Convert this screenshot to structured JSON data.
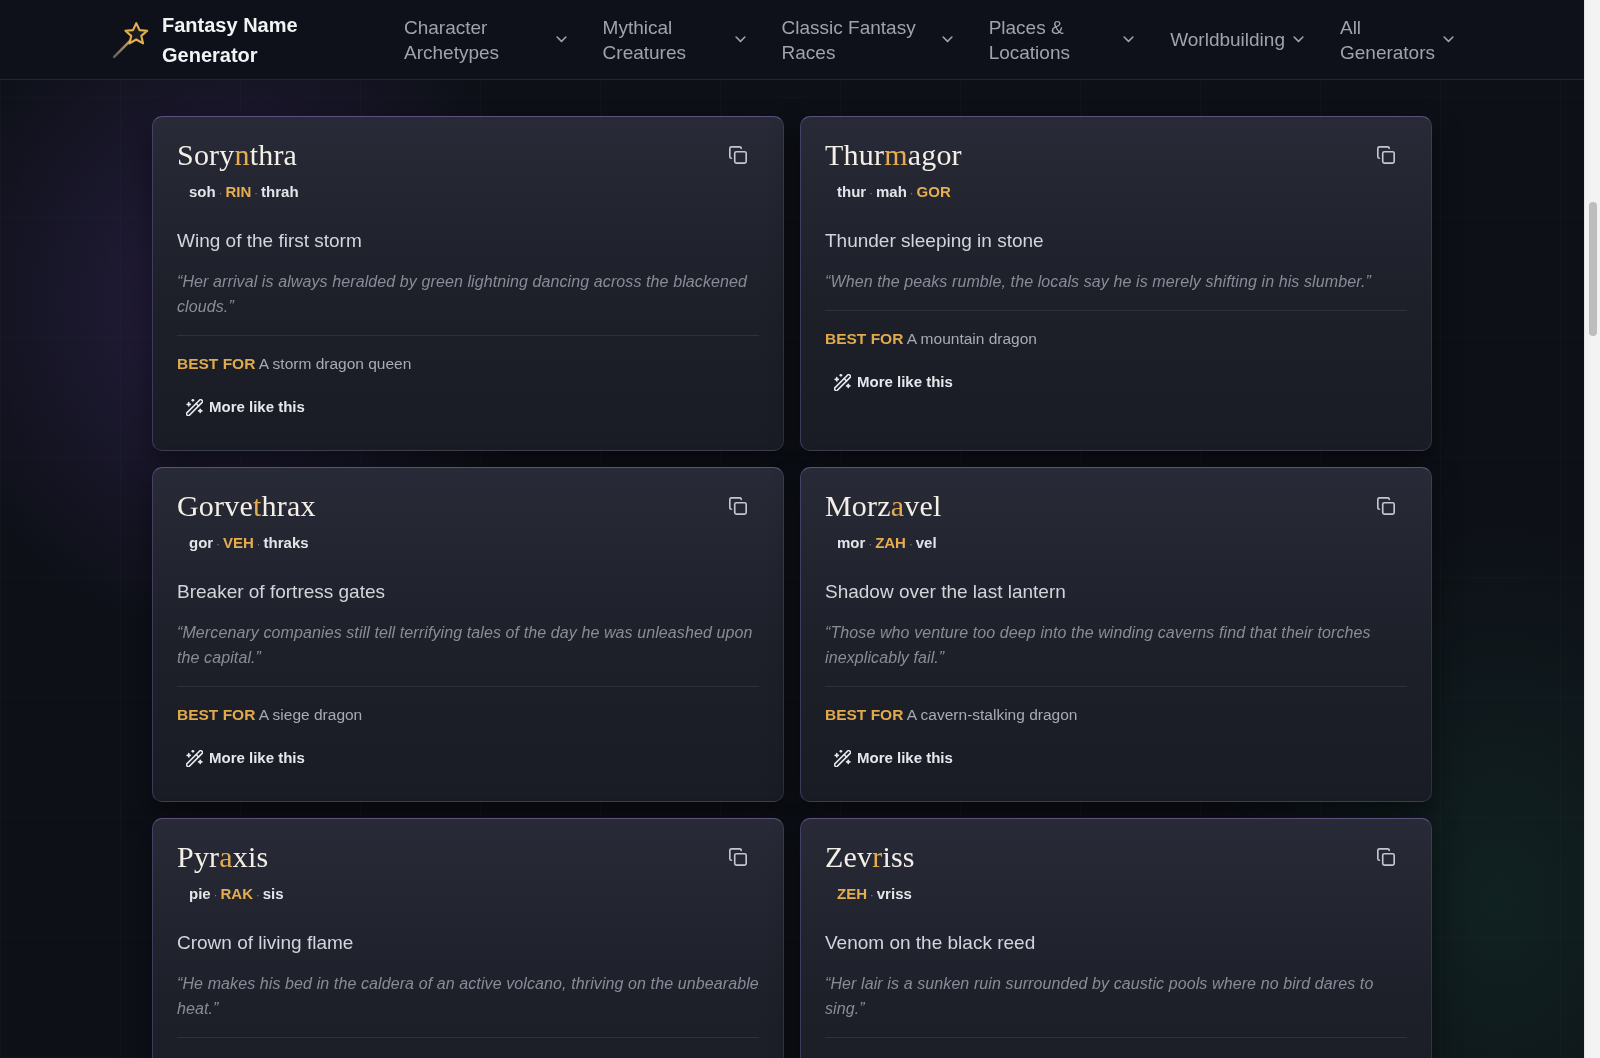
{
  "header": {
    "brand": "Fantasy Name Generator",
    "nav": [
      "Character Archetypes",
      "Mythical Creatures",
      "Classic Fantasy Races",
      "Places & Locations",
      "Worldbuilding",
      "All Generators"
    ]
  },
  "cards": [
    {
      "name": [
        {
          "text": "Sory",
          "accent": false
        },
        {
          "text": "n",
          "accent": true
        },
        {
          "text": "thra",
          "accent": false
        }
      ],
      "pronunciation": {
        "separator": "·",
        "syllables": [
          {
            "text": "soh",
            "stressed": false
          },
          {
            "text": "RIN",
            "stressed": true
          },
          {
            "text": "thrah",
            "stressed": false
          }
        ]
      },
      "meaning": "Wing of the first storm",
      "quote": "“Her arrival is always heralded by green lightning dancing across the blackened clouds.”",
      "best_for": {
        "label": "BEST FOR",
        "text": "A storm dragon queen"
      },
      "action": "More like this"
    },
    {
      "name": [
        {
          "text": "Thur",
          "accent": false
        },
        {
          "text": "m",
          "accent": true
        },
        {
          "text": "agor",
          "accent": false
        }
      ],
      "pronunciation": {
        "separator": "·",
        "syllables": [
          {
            "text": "thur",
            "stressed": false
          },
          {
            "text": "mah",
            "stressed": false
          },
          {
            "text": "GOR",
            "stressed": true
          }
        ]
      },
      "meaning": "Thunder sleeping in stone",
      "quote": "“When the peaks rumble, the locals say he is merely shifting in his slumber.”",
      "best_for": {
        "label": "BEST FOR",
        "text": "A mountain dragon"
      },
      "action": "More like this"
    },
    {
      "name": [
        {
          "text": "Gorve",
          "accent": false
        },
        {
          "text": "t",
          "accent": true
        },
        {
          "text": "hrax",
          "accent": false
        }
      ],
      "pronunciation": {
        "separator": "·",
        "syllables": [
          {
            "text": "gor",
            "stressed": false
          },
          {
            "text": "VEH",
            "stressed": true
          },
          {
            "text": "thraks",
            "stressed": false
          }
        ]
      },
      "meaning": "Breaker of fortress gates",
      "quote": "“Mercenary companies still tell terrifying tales of the day he was unleashed upon the capital.”",
      "best_for": {
        "label": "BEST FOR",
        "text": "A siege dragon"
      },
      "action": "More like this"
    },
    {
      "name": [
        {
          "text": "Morz",
          "accent": false
        },
        {
          "text": "a",
          "accent": true
        },
        {
          "text": "vel",
          "accent": false
        }
      ],
      "pronunciation": {
        "separator": "·",
        "syllables": [
          {
            "text": "mor",
            "stressed": false
          },
          {
            "text": "ZAH",
            "stressed": true
          },
          {
            "text": "vel",
            "stressed": false
          }
        ]
      },
      "meaning": "Shadow over the last lantern",
      "quote": "“Those who venture too deep into the winding caverns find that their torches inexplicably fail.”",
      "best_for": {
        "label": "BEST FOR",
        "text": "A cavern-stalking dragon"
      },
      "action": "More like this"
    },
    {
      "name": [
        {
          "text": "Pyr",
          "accent": false
        },
        {
          "text": "a",
          "accent": true
        },
        {
          "text": "xis",
          "accent": false
        }
      ],
      "pronunciation": {
        "separator": "·",
        "syllables": [
          {
            "text": "pie",
            "stressed": false
          },
          {
            "text": "RAK",
            "stressed": true
          },
          {
            "text": "sis",
            "stressed": false
          }
        ]
      },
      "meaning": "Crown of living flame",
      "quote": "“He makes his bed in the caldera of an active volcano, thriving on the unbearable heat.”"
    },
    {
      "name": [
        {
          "text": "Zev",
          "accent": false
        },
        {
          "text": "r",
          "accent": true
        },
        {
          "text": "iss",
          "accent": false
        }
      ],
      "pronunciation": {
        "separator": "·",
        "syllables": [
          {
            "text": "ZEH",
            "stressed": true
          },
          {
            "text": "vriss",
            "stressed": false
          }
        ]
      },
      "meaning": "Venom on the black reed",
      "quote": "“Her lair is a sunken ruin surrounded by caustic pools where no bird dares to sing.”"
    }
  ]
}
